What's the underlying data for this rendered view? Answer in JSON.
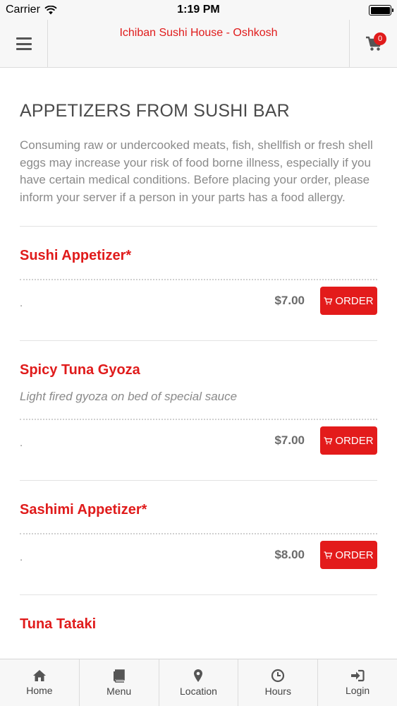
{
  "status_bar": {
    "carrier": "Carrier",
    "time": "1:19 PM"
  },
  "header": {
    "title": "Ichiban Sushi House - Oshkosh",
    "cart_count": "0"
  },
  "section": {
    "title": "APPETIZERS FROM SUSHI BAR",
    "description": "Consuming raw or undercooked meats, fish, shellfish or fresh shell eggs may increase your risk of food borne illness, especially if you have certain medical conditions. Before placing your order, please inform your server if a person in your parts has a food allergy."
  },
  "items": [
    {
      "name": "Sushi Appetizer*",
      "description": "",
      "dot": ".",
      "price": "$7.00",
      "order_label": "ORDER"
    },
    {
      "name": "Spicy Tuna Gyoza",
      "description": "Light fired gyoza on bed of special sauce",
      "dot": ".",
      "price": "$7.00",
      "order_label": "ORDER"
    },
    {
      "name": "Sashimi Appetizer*",
      "description": "",
      "dot": ".",
      "price": "$8.00",
      "order_label": "ORDER"
    },
    {
      "name": "Tuna Tataki",
      "description": "",
      "dot": "",
      "price": "",
      "order_label": ""
    }
  ],
  "bottom_nav": {
    "home": "Home",
    "menu": "Menu",
    "location": "Location",
    "hours": "Hours",
    "login": "Login"
  },
  "colors": {
    "accent": "#e01b1b",
    "order_button": "#e31b1b",
    "header_bg": "#f7f7f7"
  },
  "icons": [
    "wifi-icon",
    "hamburger-icon",
    "cart-icon",
    "home-icon",
    "book-icon",
    "map-pin-icon",
    "clock-icon",
    "sign-in-icon"
  ]
}
